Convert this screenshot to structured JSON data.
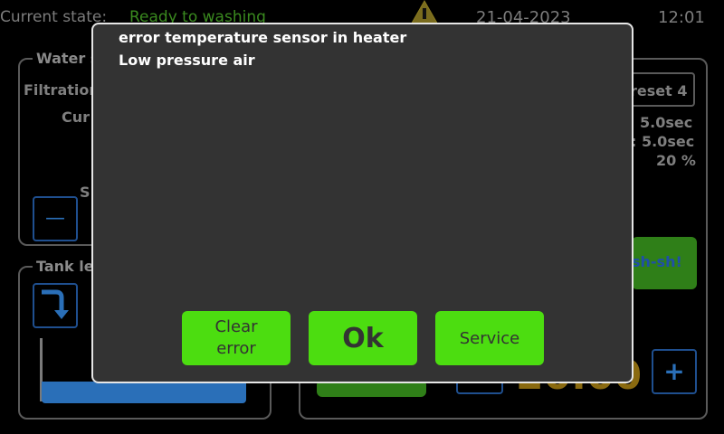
{
  "header": {
    "state_label": "Current state:",
    "state_value": "Ready to washing",
    "date": "21-04-2023",
    "time": "12:01",
    "warning_icon": "warning-icon"
  },
  "background": {
    "water_panel_title": "Water s",
    "filtration_label": "Filtration",
    "current_label": "Cur",
    "set_label": "S",
    "preset_button": "reset 4",
    "value1": "5.0sec",
    "value2": ": 5.0sec",
    "value3": "20 %",
    "tank_panel_title": "Tank le",
    "flush_button": "sh-sh!",
    "minus_label": "—",
    "plus_label": "+",
    "big_value": "20.00"
  },
  "dialog": {
    "errors": [
      "error temperature sensor in heater",
      "Low pressure air"
    ],
    "buttons": {
      "clear": "Clear error",
      "ok": "Ok",
      "service": "Service"
    }
  },
  "colors": {
    "dialog_bg": "#333333",
    "button_green": "#4cdd10",
    "state_green": "#3a8a1f",
    "warning_yellow": "#8a7a20"
  }
}
